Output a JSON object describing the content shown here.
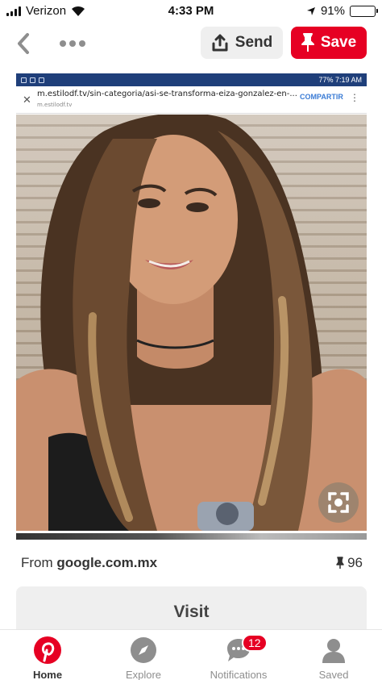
{
  "status_bar": {
    "carrier": "Verizon",
    "time": "4:33 PM",
    "battery": "91%",
    "battery_level": 0.91
  },
  "header": {
    "send_label": "Send",
    "save_label": "Save"
  },
  "pin_screenshot": {
    "status_right": "77% 7:19 AM",
    "url": "m.estilodf.tv/sin-categoria/asi-se-transforma-eiza-gonzalez-en-...",
    "url_sub": "m.estilodf.tv",
    "share_label": "COMPARTIR"
  },
  "source": {
    "prefix": "From",
    "domain": "google.com.mx"
  },
  "saves_count": "96",
  "visit_label": "Visit",
  "tabs": [
    {
      "label": "Home",
      "icon": "pinterest-logo-icon"
    },
    {
      "label": "Explore",
      "icon": "compass-icon"
    },
    {
      "label": "Notifications",
      "icon": "speech-bubble-icon",
      "badge": "12"
    },
    {
      "label": "Saved",
      "icon": "person-icon"
    }
  ],
  "colors": {
    "brand_red": "#e60023",
    "button_gray": "#efefef",
    "text": "#333333"
  }
}
